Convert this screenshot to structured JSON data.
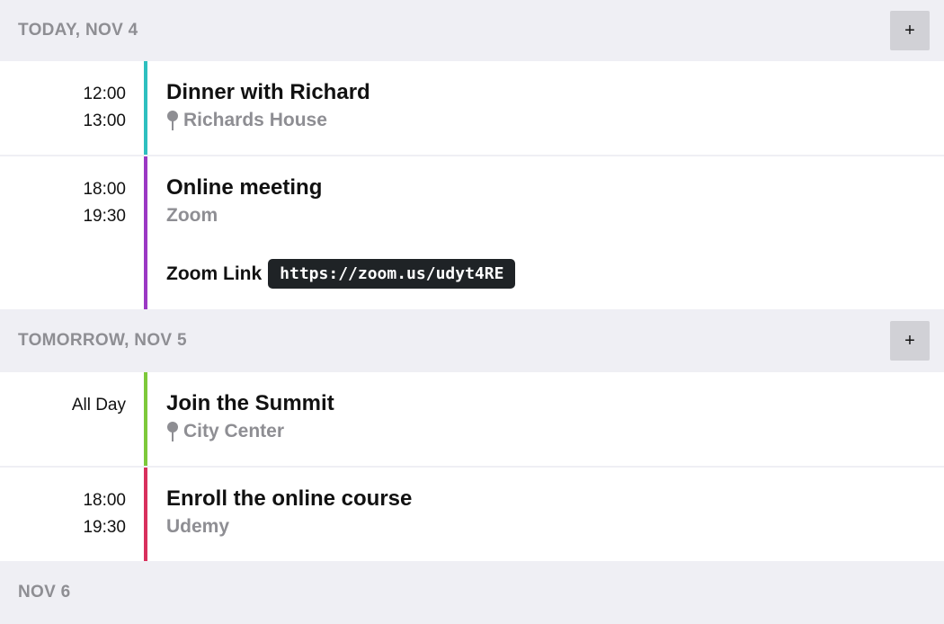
{
  "days": [
    {
      "label": "TODAY, NOV 4",
      "add_label": "+",
      "events": [
        {
          "start": "12:00",
          "end": "13:00",
          "title": "Dinner with Richard",
          "location": "Richards House",
          "color": "#2ebfbf"
        },
        {
          "start": "18:00",
          "end": "19:30",
          "title": "Online meeting",
          "location": "Zoom",
          "link_label": "Zoom Link",
          "link_value": "https://zoom.us/udyt4RE",
          "color": "#9b38c4"
        }
      ]
    },
    {
      "label": "TOMORROW, NOV 5",
      "add_label": "+",
      "events": [
        {
          "time": "All Day",
          "title": "Join the Summit",
          "location": "City Center",
          "color": "#7dc93a"
        },
        {
          "start": "18:00",
          "end": "19:30",
          "title": "Enroll the online course",
          "location": "Udemy",
          "color": "#d8305d"
        }
      ]
    },
    {
      "label": "NOV 6"
    }
  ],
  "icons": {
    "location": "map-pin-icon"
  }
}
